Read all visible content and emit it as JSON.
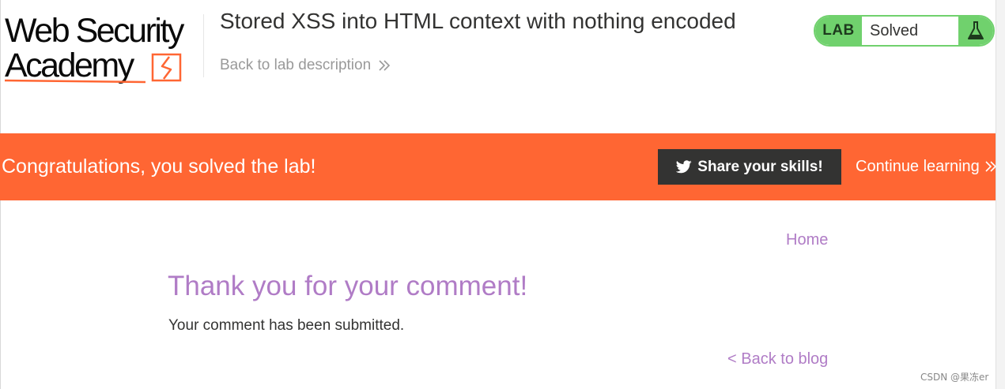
{
  "header": {
    "logo": {
      "line1": "Web Security",
      "line2": "Academy"
    },
    "lab_title": "Stored XSS into HTML context with nothing encoded",
    "back_to_description": "Back to lab description",
    "lab_badge": {
      "tag": "LAB",
      "status": "Solved",
      "icon": "flask-icon"
    }
  },
  "banner": {
    "message": "Congratulations, you solved the lab!",
    "share_button": "Share your skills!",
    "share_icon": "twitter-icon",
    "continue_link": "Continue learning"
  },
  "nav": {
    "home_link": "Home"
  },
  "main": {
    "heading": "Thank you for your comment!",
    "message": "Your comment has been submitted.",
    "back_link": "< Back to blog"
  },
  "watermark": "CSDN @果冻er",
  "colors": {
    "accent_orange": "#ff6633",
    "lab_green": "#70d16d",
    "link_purple": "#b07cc6",
    "dark_button": "#333332"
  }
}
